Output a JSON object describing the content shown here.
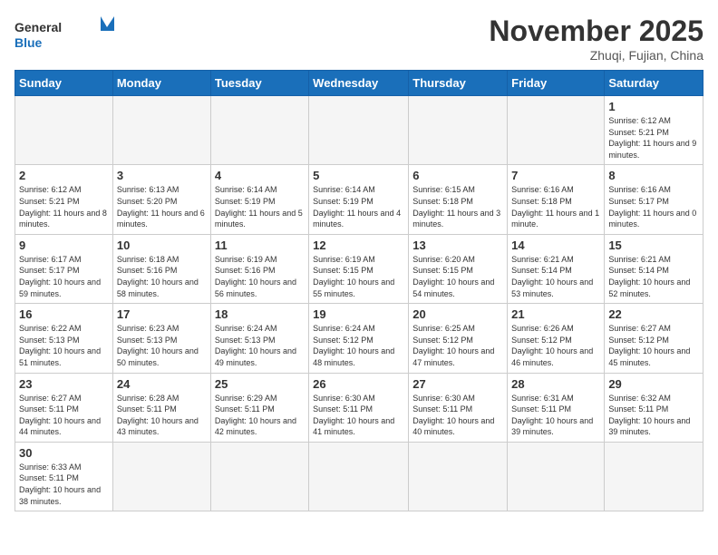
{
  "header": {
    "logo_general": "General",
    "logo_blue": "Blue",
    "month_title": "November 2025",
    "location": "Zhuqi, Fujian, China"
  },
  "weekdays": [
    "Sunday",
    "Monday",
    "Tuesday",
    "Wednesday",
    "Thursday",
    "Friday",
    "Saturday"
  ],
  "days": {
    "d1": {
      "num": "1",
      "rise": "6:12 AM",
      "set": "5:21 PM",
      "daylight": "11 hours and 9 minutes."
    },
    "d2": {
      "num": "2",
      "rise": "6:12 AM",
      "set": "5:21 PM",
      "daylight": "11 hours and 8 minutes."
    },
    "d3": {
      "num": "3",
      "rise": "6:13 AM",
      "set": "5:20 PM",
      "daylight": "11 hours and 6 minutes."
    },
    "d4": {
      "num": "4",
      "rise": "6:14 AM",
      "set": "5:19 PM",
      "daylight": "11 hours and 5 minutes."
    },
    "d5": {
      "num": "5",
      "rise": "6:14 AM",
      "set": "5:19 PM",
      "daylight": "11 hours and 4 minutes."
    },
    "d6": {
      "num": "6",
      "rise": "6:15 AM",
      "set": "5:18 PM",
      "daylight": "11 hours and 3 minutes."
    },
    "d7": {
      "num": "7",
      "rise": "6:16 AM",
      "set": "5:18 PM",
      "daylight": "11 hours and 1 minute."
    },
    "d8": {
      "num": "8",
      "rise": "6:16 AM",
      "set": "5:17 PM",
      "daylight": "11 hours and 0 minutes."
    },
    "d9": {
      "num": "9",
      "rise": "6:17 AM",
      "set": "5:17 PM",
      "daylight": "10 hours and 59 minutes."
    },
    "d10": {
      "num": "10",
      "rise": "6:18 AM",
      "set": "5:16 PM",
      "daylight": "10 hours and 58 minutes."
    },
    "d11": {
      "num": "11",
      "rise": "6:19 AM",
      "set": "5:16 PM",
      "daylight": "10 hours and 56 minutes."
    },
    "d12": {
      "num": "12",
      "rise": "6:19 AM",
      "set": "5:15 PM",
      "daylight": "10 hours and 55 minutes."
    },
    "d13": {
      "num": "13",
      "rise": "6:20 AM",
      "set": "5:15 PM",
      "daylight": "10 hours and 54 minutes."
    },
    "d14": {
      "num": "14",
      "rise": "6:21 AM",
      "set": "5:14 PM",
      "daylight": "10 hours and 53 minutes."
    },
    "d15": {
      "num": "15",
      "rise": "6:21 AM",
      "set": "5:14 PM",
      "daylight": "10 hours and 52 minutes."
    },
    "d16": {
      "num": "16",
      "rise": "6:22 AM",
      "set": "5:13 PM",
      "daylight": "10 hours and 51 minutes."
    },
    "d17": {
      "num": "17",
      "rise": "6:23 AM",
      "set": "5:13 PM",
      "daylight": "10 hours and 50 minutes."
    },
    "d18": {
      "num": "18",
      "rise": "6:24 AM",
      "set": "5:13 PM",
      "daylight": "10 hours and 49 minutes."
    },
    "d19": {
      "num": "19",
      "rise": "6:24 AM",
      "set": "5:12 PM",
      "daylight": "10 hours and 48 minutes."
    },
    "d20": {
      "num": "20",
      "rise": "6:25 AM",
      "set": "5:12 PM",
      "daylight": "10 hours and 47 minutes."
    },
    "d21": {
      "num": "21",
      "rise": "6:26 AM",
      "set": "5:12 PM",
      "daylight": "10 hours and 46 minutes."
    },
    "d22": {
      "num": "22",
      "rise": "6:27 AM",
      "set": "5:12 PM",
      "daylight": "10 hours and 45 minutes."
    },
    "d23": {
      "num": "23",
      "rise": "6:27 AM",
      "set": "5:11 PM",
      "daylight": "10 hours and 44 minutes."
    },
    "d24": {
      "num": "24",
      "rise": "6:28 AM",
      "set": "5:11 PM",
      "daylight": "10 hours and 43 minutes."
    },
    "d25": {
      "num": "25",
      "rise": "6:29 AM",
      "set": "5:11 PM",
      "daylight": "10 hours and 42 minutes."
    },
    "d26": {
      "num": "26",
      "rise": "6:30 AM",
      "set": "5:11 PM",
      "daylight": "10 hours and 41 minutes."
    },
    "d27": {
      "num": "27",
      "rise": "6:30 AM",
      "set": "5:11 PM",
      "daylight": "10 hours and 40 minutes."
    },
    "d28": {
      "num": "28",
      "rise": "6:31 AM",
      "set": "5:11 PM",
      "daylight": "10 hours and 39 minutes."
    },
    "d29": {
      "num": "29",
      "rise": "6:32 AM",
      "set": "5:11 PM",
      "daylight": "10 hours and 39 minutes."
    },
    "d30": {
      "num": "30",
      "rise": "6:33 AM",
      "set": "5:11 PM",
      "daylight": "10 hours and 38 minutes."
    }
  },
  "labels": {
    "sunrise": "Sunrise:",
    "sunset": "Sunset:",
    "daylight": "Daylight:"
  }
}
